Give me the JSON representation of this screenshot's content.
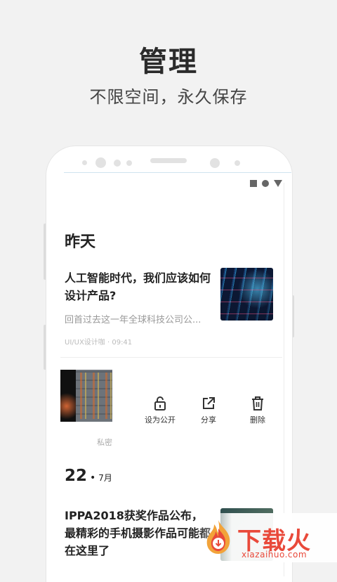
{
  "hero": {
    "title": "管理",
    "subtitle": "不限空间，永久保存"
  },
  "section": {
    "yesterday_label": "昨天"
  },
  "article1": {
    "title": "人工智能时代，我们应该如何设计产品?",
    "description": "回首过去这一年全球科技公司公...",
    "meta": "UI/UX设计咖 · 09:41"
  },
  "private_item": {
    "label": "私密"
  },
  "actions": [
    {
      "label": "设为公开",
      "icon": "lock-icon"
    },
    {
      "label": "分享",
      "icon": "share-icon"
    },
    {
      "label": "删除",
      "icon": "trash-icon"
    }
  ],
  "date_group": {
    "day": "22",
    "dot": "•",
    "month": "7月"
  },
  "article2": {
    "title": "IPPA2018获奖作品公布，最精彩的手机摄影作品可能都在这里了"
  },
  "watermark": {
    "brand": "下载火",
    "url": "xiazaihuo.com"
  },
  "colors": {
    "background": "#f2f2f2",
    "watermark": "#e9493a"
  }
}
